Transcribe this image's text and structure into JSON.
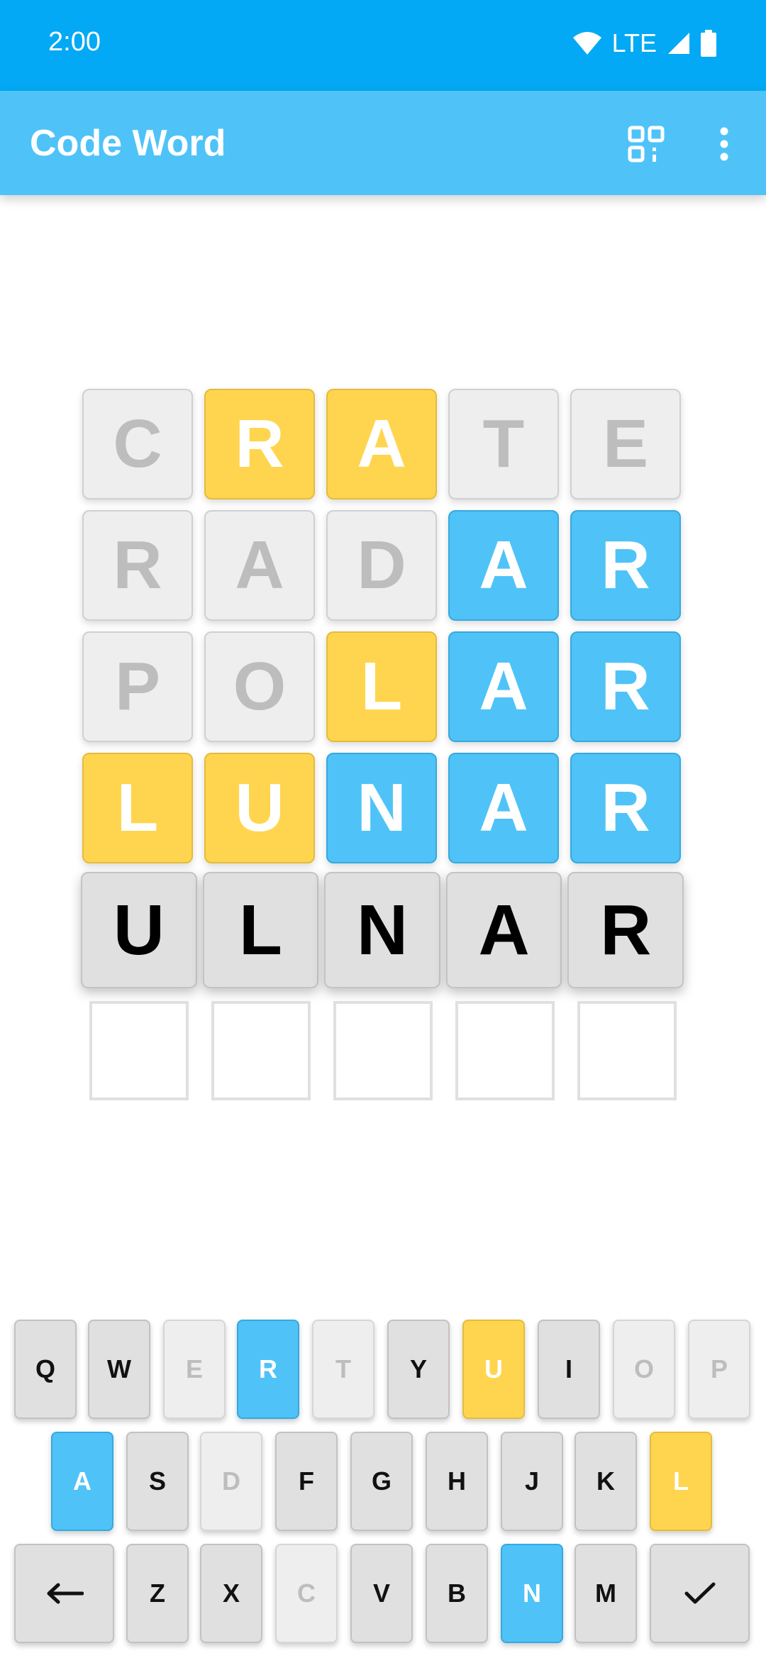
{
  "status": {
    "time": "2:00",
    "network": "LTE"
  },
  "appbar": {
    "title": "Code Word"
  },
  "board": {
    "guesses": [
      [
        {
          "letter": "C",
          "state": "absent"
        },
        {
          "letter": "R",
          "state": "present"
        },
        {
          "letter": "A",
          "state": "present"
        },
        {
          "letter": "T",
          "state": "absent"
        },
        {
          "letter": "E",
          "state": "absent"
        }
      ],
      [
        {
          "letter": "R",
          "state": "absent"
        },
        {
          "letter": "A",
          "state": "absent"
        },
        {
          "letter": "D",
          "state": "absent"
        },
        {
          "letter": "A",
          "state": "correct"
        },
        {
          "letter": "R",
          "state": "correct"
        }
      ],
      [
        {
          "letter": "P",
          "state": "absent"
        },
        {
          "letter": "O",
          "state": "absent"
        },
        {
          "letter": "L",
          "state": "present"
        },
        {
          "letter": "A",
          "state": "correct"
        },
        {
          "letter": "R",
          "state": "correct"
        }
      ],
      [
        {
          "letter": "L",
          "state": "present"
        },
        {
          "letter": "U",
          "state": "present"
        },
        {
          "letter": "N",
          "state": "correct"
        },
        {
          "letter": "A",
          "state": "correct"
        },
        {
          "letter": "R",
          "state": "correct"
        }
      ]
    ],
    "current": [
      "U",
      "L",
      "N",
      "A",
      "R"
    ],
    "empty_slots": 5
  },
  "keyboard": {
    "rows": [
      [
        {
          "label": "Q",
          "state": "neutral"
        },
        {
          "label": "W",
          "state": "neutral"
        },
        {
          "label": "E",
          "state": "absent"
        },
        {
          "label": "R",
          "state": "correct"
        },
        {
          "label": "T",
          "state": "absent"
        },
        {
          "label": "Y",
          "state": "neutral"
        },
        {
          "label": "U",
          "state": "present"
        },
        {
          "label": "I",
          "state": "neutral"
        },
        {
          "label": "O",
          "state": "absent"
        },
        {
          "label": "P",
          "state": "absent"
        }
      ],
      [
        {
          "label": "A",
          "state": "correct"
        },
        {
          "label": "S",
          "state": "neutral"
        },
        {
          "label": "D",
          "state": "absent"
        },
        {
          "label": "F",
          "state": "neutral"
        },
        {
          "label": "G",
          "state": "neutral"
        },
        {
          "label": "H",
          "state": "neutral"
        },
        {
          "label": "J",
          "state": "neutral"
        },
        {
          "label": "K",
          "state": "neutral"
        },
        {
          "label": "L",
          "state": "present"
        }
      ],
      [
        {
          "label": "←",
          "state": "neutral",
          "icon": "backspace-icon"
        },
        {
          "label": "Z",
          "state": "neutral"
        },
        {
          "label": "X",
          "state": "neutral"
        },
        {
          "label": "C",
          "state": "absent"
        },
        {
          "label": "V",
          "state": "neutral"
        },
        {
          "label": "B",
          "state": "neutral"
        },
        {
          "label": "N",
          "state": "correct"
        },
        {
          "label": "M",
          "state": "neutral"
        },
        {
          "label": "✓",
          "state": "neutral",
          "icon": "check-icon"
        }
      ]
    ]
  },
  "colors": {
    "statusbar": "#03a9f4",
    "appbar": "#4fc3f7",
    "correct": "#4fc3f7",
    "present": "#ffd54f",
    "absent": "#eeeeee",
    "neutral": "#e0e0e0"
  }
}
